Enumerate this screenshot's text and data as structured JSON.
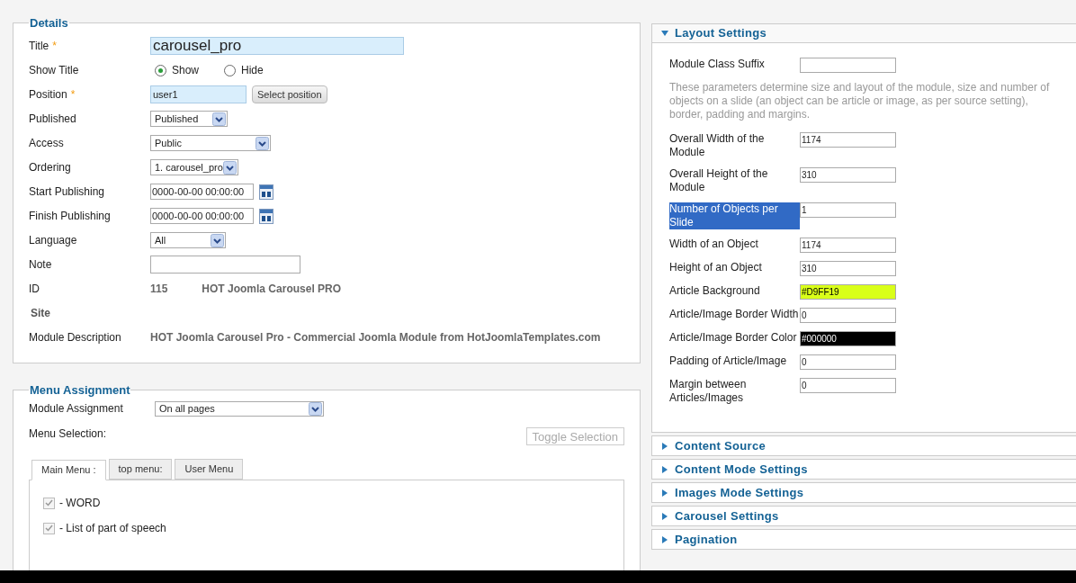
{
  "details": {
    "legend": "Details",
    "fields": [
      {
        "kind": "text",
        "label": "Title",
        "required_mark": "*",
        "highlighted": true,
        "value": "carousel_pro"
      },
      {
        "kind": "radio",
        "label": "Show Title",
        "options": [
          {
            "label": "Show",
            "selected": true
          },
          {
            "label": "Hide",
            "selected": false
          }
        ]
      },
      {
        "kind": "text",
        "label": "Position",
        "required_mark": "*",
        "highlighted": true,
        "value": "user1",
        "button": "Select position"
      },
      {
        "kind": "select",
        "label": "Published",
        "value": "Published"
      },
      {
        "kind": "select",
        "label": "Access",
        "value": "Public"
      },
      {
        "kind": "select",
        "label": "Ordering",
        "value": "1. carousel_pro"
      },
      {
        "kind": "date",
        "label": "Start Publishing",
        "value": "0000-00-00 00:00:00"
      },
      {
        "kind": "date",
        "label": "Finish Publishing",
        "value": "0000-00-00 00:00:00"
      },
      {
        "kind": "select",
        "label": "Language",
        "value": "All"
      },
      {
        "kind": "text",
        "label": "Note",
        "highlighted": false
      },
      {
        "kind": "info",
        "label": "ID",
        "value": "115",
        "extra": "HOT Joomla Carousel PRO"
      },
      {
        "kind": "heading",
        "label": "Site"
      },
      {
        "kind": "info",
        "label": "Module Description",
        "value": "HOT Joomla Carousel Pro - Commercial Joomla Module from HotJoomlaTemplates.com"
      }
    ]
  },
  "menu_assignment": {
    "legend": "Menu Assignment",
    "assignment_label": "Module Assignment",
    "assignment_value": "On all pages",
    "selection_label": "Menu Selection:",
    "toggle_button": "Toggle Selection",
    "tabs": [
      {
        "label": "Main Menu :",
        "selected": true
      },
      {
        "label": "top menu:",
        "selected": false
      },
      {
        "label": "User Menu",
        "selected": false
      }
    ],
    "items": [
      {
        "label": "- WORD",
        "checked": true
      },
      {
        "label": "- List of part of speech",
        "checked": true
      }
    ]
  },
  "panels": [
    {
      "title": "Layout Settings",
      "expanded": true,
      "fields": [
        {
          "kind": "text",
          "label": "Module Class Suffix",
          "text_selected": false
        },
        {
          "kind": "note",
          "text": "These parameters determine size and layout of the module, size and number of objects on a slide (an object can be article or image, as per source setting), border, padding and margins."
        },
        {
          "kind": "text",
          "label": "Overall Width of the Module",
          "value": "1174",
          "text_selected": false
        },
        {
          "kind": "text",
          "label": "Overall Height of the Module",
          "value": "310",
          "text_selected": false
        },
        {
          "kind": "text",
          "label": "Number of Objects per Slide",
          "value": "1",
          "text_selected": true
        },
        {
          "kind": "text",
          "label": "Width of an Object",
          "value": "1174",
          "text_selected": false
        },
        {
          "kind": "text",
          "label": "Height of an Object",
          "value": "310",
          "text_selected": false
        },
        {
          "kind": "color",
          "label": "Article Background",
          "value": "#D9FF19",
          "color": "#d9ff19",
          "text_selected": false
        },
        {
          "kind": "text",
          "label": "Article/Image Border Width",
          "value": "0",
          "text_selected": false
        },
        {
          "kind": "color",
          "label": "Article/Image Border Color",
          "value": "#000000",
          "color": "#000000",
          "text_selected": false
        },
        {
          "kind": "text",
          "label": "Padding of Article/Image",
          "value": "0",
          "text_selected": false
        },
        {
          "kind": "text",
          "label": "Margin between Articles/Images",
          "value": "0",
          "text_selected": false
        }
      ]
    },
    {
      "title": "Content Source",
      "expanded": false
    },
    {
      "title": "Content Mode Settings",
      "expanded": false
    },
    {
      "title": "Images Mode Settings",
      "expanded": false
    },
    {
      "title": "Carousel Settings",
      "expanded": false
    },
    {
      "title": "Pagination",
      "expanded": false
    }
  ]
}
